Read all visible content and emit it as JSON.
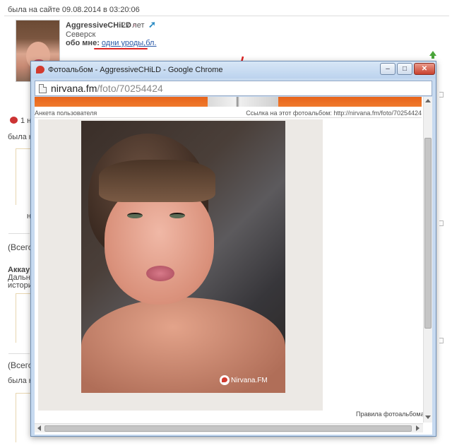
{
  "background": {
    "last_seen": "была на сайте 09.08.2014 в 03:20:06",
    "user": {
      "name": "AggressiveCHiLD",
      "gender_symbol": "♀",
      "age": "27 лет",
      "city": "Северск",
      "about_label": "обо мне:",
      "about_value": "одни уроды,бл."
    },
    "fragments": {
      "reaction_text": "1 н",
      "was_on": "была на",
      "n_letter": "н",
      "total_a": "(Всего",
      "account": "Аккау",
      "further": "Дальне",
      "history": "истори",
      "total_b": "(Всего",
      "was_on_b": "была на"
    }
  },
  "popup": {
    "window_title": "Фотоальбом - AggressiveCHiLD - Google Chrome",
    "buttons": {
      "minimize": "–",
      "maximize": "□",
      "close": "✕"
    },
    "address": {
      "domain": "nirvana.fm",
      "path": "/foto/70254424"
    },
    "subnav": {
      "left": "Анкета пользователя",
      "right": "Ссылка на этот фотоальбом: http://nirvana.fm/foto/70254424"
    },
    "watermark": "Nirvana.FM",
    "rules_link": "Правила фотоальбома"
  },
  "colors": {
    "banner": "#e7641b",
    "titlebar": "#c7daf0",
    "close_button": "#c9412f",
    "annotation": "#dd2222",
    "link": "#2b5aa8"
  },
  "icons": [
    "site-favicon",
    "page-icon",
    "green-up-arrow-icon",
    "external-link-icon",
    "reaction-icon",
    "nirvana-logo-icon"
  ]
}
